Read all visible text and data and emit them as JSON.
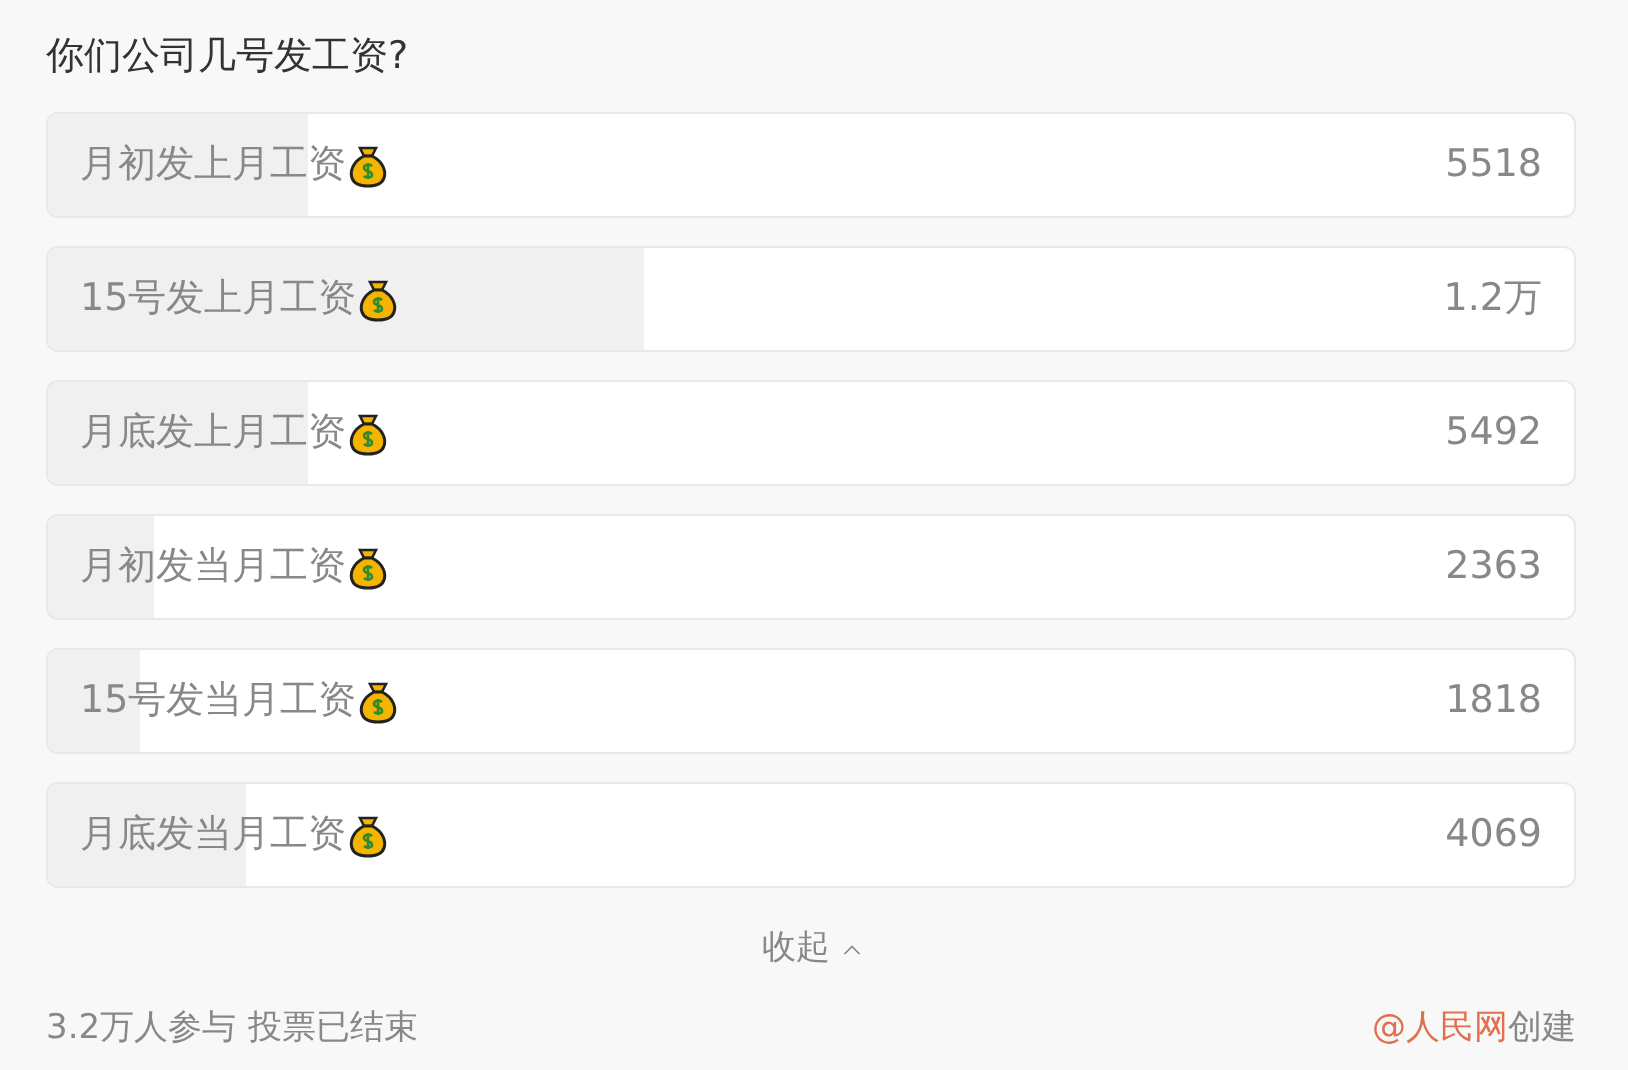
{
  "title": "你们公司几号发工资?",
  "options": [
    {
      "label": "月初发上月工资",
      "count": "5518",
      "level": 0.17
    },
    {
      "label": "15号发上月工资",
      "count": "1.2万",
      "level": 0.39
    },
    {
      "label": "月底发上月工资",
      "count": "5492",
      "level": 0.17
    },
    {
      "label": "月初发当月工资",
      "count": "2363",
      "level": 0.07
    },
    {
      "label": "15号发当月工资",
      "count": "1818",
      "level": 0.06
    },
    {
      "label": "月底发当月工资",
      "count": "4069",
      "level": 0.13
    }
  ],
  "collapse": "收起",
  "participants": "3.2万人参与",
  "status": "投票已结束",
  "creator": "@人民网",
  "created": "创建"
}
